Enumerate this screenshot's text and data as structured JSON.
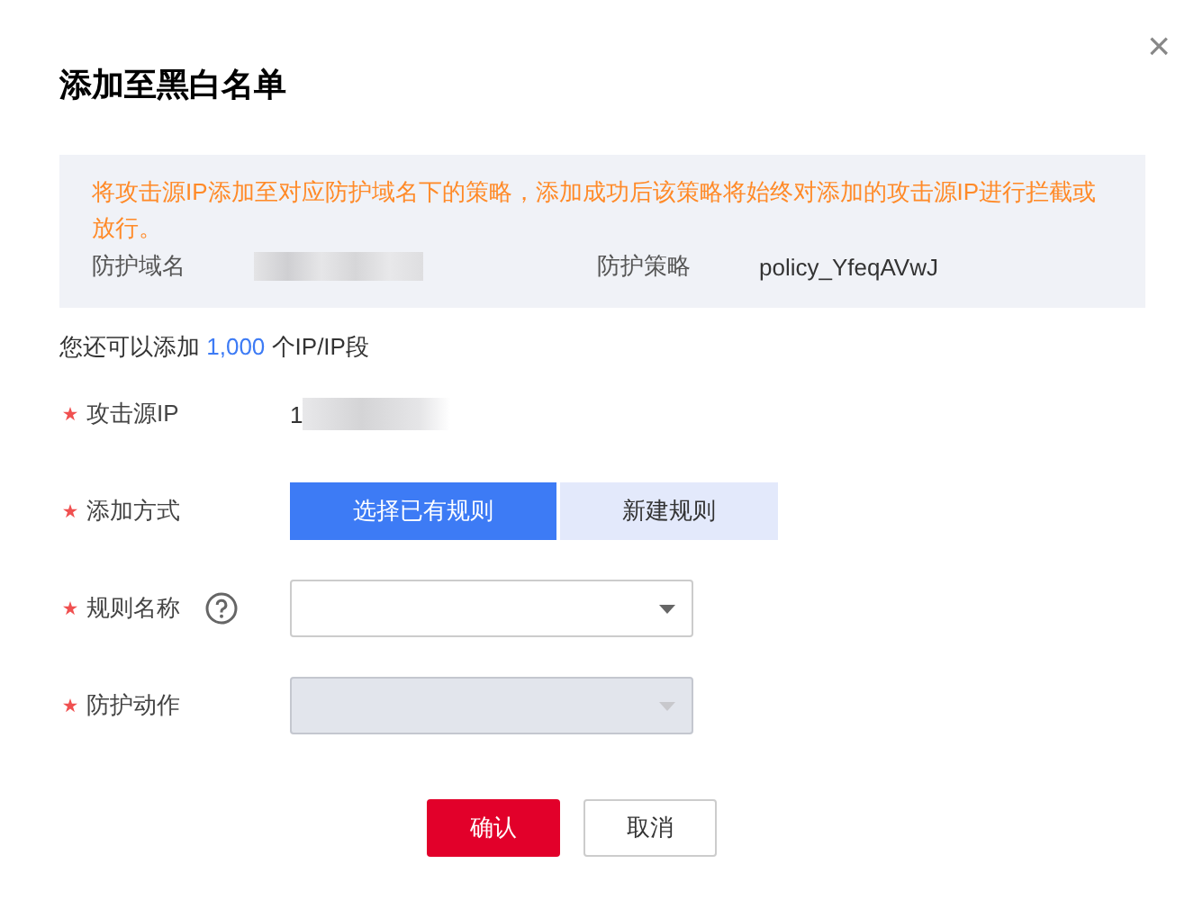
{
  "dialog": {
    "title": "添加至黑白名单",
    "close": "×"
  },
  "notice": {
    "message": "将攻击源IP添加至对应防护域名下的策略，添加成功后该策略将始终对添加的攻击源IP进行拦截或放行。",
    "fields": [
      {
        "label": "防护域名"
      },
      {
        "label": "防护策略",
        "value": "policy_YfeqAVwJ"
      }
    ]
  },
  "quota": {
    "prefix": "您还可以添加 ",
    "count": "1,000",
    "suffix": " 个IP/IP段"
  },
  "form": [
    {
      "kind": "text",
      "label": "攻击源IP",
      "required": true,
      "value": "1",
      "redacted": true
    },
    {
      "kind": "segmented",
      "label": "添加方式",
      "required": true,
      "options": [
        {
          "label": "选择已有规则",
          "selected": true
        },
        {
          "label": "新建规则",
          "selected": false
        }
      ]
    },
    {
      "kind": "select",
      "label": "规则名称",
      "required": true,
      "help": true,
      "disabled": false
    },
    {
      "kind": "select",
      "label": "防护动作",
      "required": true,
      "help": false,
      "disabled": true
    }
  ],
  "buttons": [
    {
      "label": "确认",
      "primary": true
    },
    {
      "label": "取消",
      "primary": false
    }
  ]
}
